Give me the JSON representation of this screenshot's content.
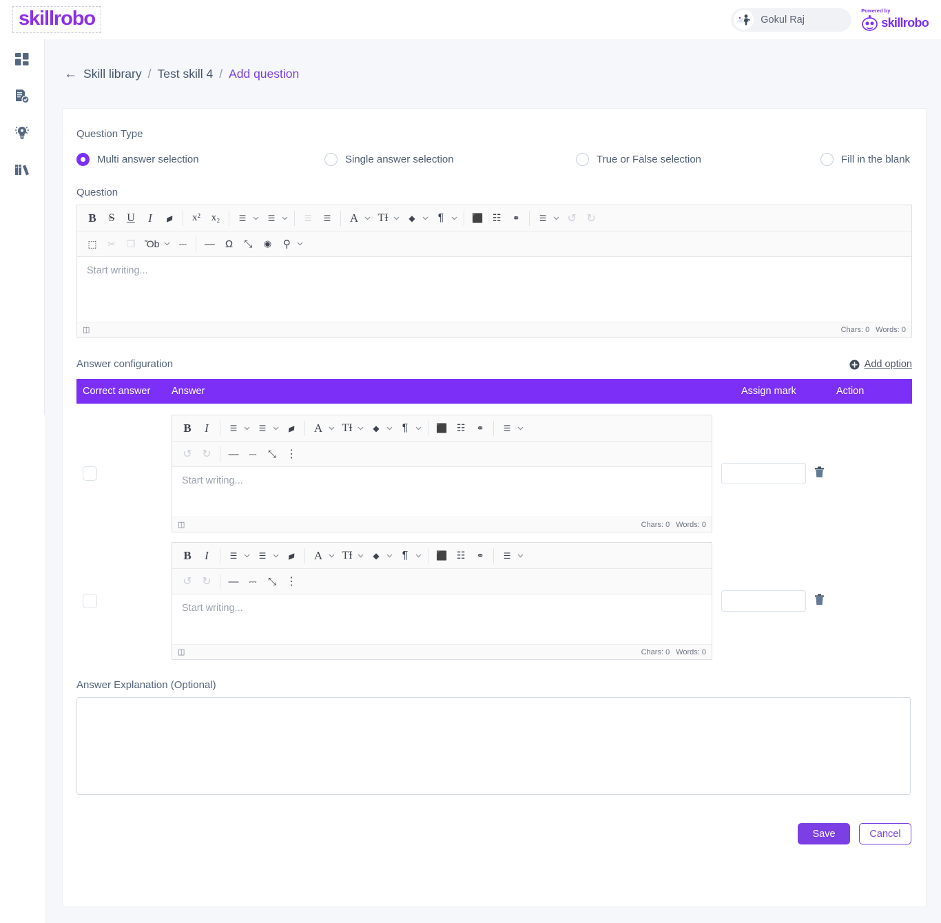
{
  "brand": {
    "logo_text": "skillrobo",
    "accent": "#7b2ff7",
    "purple_header": "#7b2ff7"
  },
  "header": {
    "user_name": "Gokul Raj",
    "powered_label": "Powered by",
    "powered_name": "skillrobo"
  },
  "sidebar": {
    "items": [
      {
        "icon": "dashboard-grid-icon",
        "name": "dashboard"
      },
      {
        "icon": "document-check-icon",
        "name": "assessments"
      },
      {
        "icon": "lightbulb-icon",
        "name": "skills"
      },
      {
        "icon": "books-icon",
        "name": "library"
      }
    ]
  },
  "breadcrumb": {
    "back": "←",
    "item1": "Skill library",
    "sep1": "/",
    "item2": "Test skill 4",
    "sep2": "/",
    "active": "Add question"
  },
  "question_type": {
    "label": "Question Type",
    "options": [
      {
        "label": "Multi answer selection",
        "selected": true
      },
      {
        "label": "Single answer selection",
        "selected": false
      },
      {
        "label": "True or False selection",
        "selected": false
      },
      {
        "label": "Fill in the blank",
        "selected": false
      }
    ]
  },
  "question": {
    "label": "Question",
    "placeholder": "Start writing...",
    "value": "",
    "chars": "Chars: 0",
    "words": "Words: 0"
  },
  "question_toolbar": {
    "row1": [
      {
        "n": "bold-icon",
        "g": "B",
        "style": "font-weight:700;font-family:'Liberation Serif',serif;font-size:17px"
      },
      {
        "n": "strikethrough-icon",
        "g": "S",
        "style": "font-family:'Liberation Serif',serif;font-size:16px;text-decoration:line-through"
      },
      {
        "n": "underline-icon",
        "g": "U",
        "style": "font-family:'Liberation Serif',serif;font-size:16px;text-decoration:underline"
      },
      {
        "n": "italic-icon",
        "g": "I",
        "style": "font-style:italic;font-family:'Liberation Serif',serif;font-size:17px"
      },
      {
        "n": "remove-format-eraser-icon",
        "g": "▰",
        "style": "font-size:15px;transform:rotate(-22deg)"
      },
      {
        "sep": true
      },
      {
        "n": "superscript-icon",
        "g": "x²",
        "style": "font-family:'Liberation Serif',serif;font-size:15px"
      },
      {
        "n": "subscript-icon",
        "g": "x₂",
        "style": "font-family:'Liberation Serif',serif;font-size:15px"
      },
      {
        "sep": true
      },
      {
        "n": "bulleted-list-icon",
        "g": "☰",
        "style": "font-size:12px"
      },
      {
        "caret": true,
        "n": "bulleted-list-dropdown-icon"
      },
      {
        "n": "numbered-list-icon",
        "g": "☰",
        "style": "font-size:12px"
      },
      {
        "caret": true,
        "n": "numbered-list-dropdown-icon"
      },
      {
        "sep": true
      },
      {
        "n": "outdent-icon",
        "g": "☰",
        "style": "font-size:12px",
        "dis": true
      },
      {
        "n": "indent-icon",
        "g": "☰",
        "style": "font-size:12px"
      },
      {
        "sep": true
      },
      {
        "n": "font-family-icon",
        "g": "A",
        "style": "font-family:'Liberation Serif',serif;font-size:17px"
      },
      {
        "caret": true,
        "n": "font-family-dropdown-icon"
      },
      {
        "n": "font-size-icon",
        "g": "TƗ",
        "style": "font-family:'Liberation Serif',serif;font-size:16px"
      },
      {
        "caret": true,
        "n": "font-size-dropdown-icon"
      },
      {
        "n": "text-color-droplet-icon",
        "g": "◆",
        "style": "font-size:12px"
      },
      {
        "caret": true,
        "n": "text-color-dropdown-icon"
      },
      {
        "n": "paragraph-format-icon",
        "g": "¶",
        "style": "font-size:16px"
      },
      {
        "caret": true,
        "n": "paragraph-format-dropdown-icon"
      },
      {
        "sep": true
      },
      {
        "n": "insert-image-icon",
        "g": "⬛",
        "style": "font-size:13px"
      },
      {
        "n": "insert-table-icon",
        "g": "☷",
        "style": "font-size:14px"
      },
      {
        "n": "insert-link-icon",
        "g": "⚭",
        "style": "font-size:13px"
      },
      {
        "sep": true
      },
      {
        "n": "align-icon",
        "g": "☰",
        "style": "font-size:12px"
      },
      {
        "caret": true,
        "n": "align-dropdown-icon"
      },
      {
        "n": "undo-icon",
        "g": "↺",
        "style": "font-size:16px",
        "dis": true
      },
      {
        "n": "redo-icon",
        "g": "↻",
        "style": "font-size:16px",
        "dis": true
      }
    ],
    "row2": [
      {
        "n": "select-all-icon",
        "g": "⬚",
        "style": "font-size:14px"
      },
      {
        "n": "cut-icon",
        "g": "✂",
        "style": "font-size:14px",
        "dis": true
      },
      {
        "n": "copy-icon",
        "g": "❐",
        "style": "font-size:14px",
        "dis": true
      },
      {
        "n": "paste-icon",
        "g": "Ὄb",
        "style": "font-size:14px"
      },
      {
        "caret": true,
        "n": "paste-dropdown-icon"
      },
      {
        "n": "format-painter-icon",
        "g": "⎓",
        "style": "font-size:14px"
      },
      {
        "sep": true
      },
      {
        "n": "horizontal-rule-icon",
        "g": "—",
        "style": "font-size:15px"
      },
      {
        "n": "special-character-icon",
        "g": "Ω",
        "style": "font-size:15px"
      },
      {
        "n": "fullscreen-icon",
        "g": "⤡",
        "style": "font-size:15px"
      },
      {
        "n": "preview-eye-icon",
        "g": "◉",
        "style": "font-size:13px"
      },
      {
        "n": "search-icon",
        "g": "⚲",
        "style": "font-size:15px"
      },
      {
        "caret": true,
        "n": "search-dropdown-icon"
      }
    ]
  },
  "answer_config": {
    "label": "Answer configuration",
    "add_option": "Add option",
    "columns": {
      "correct": "Correct answer",
      "answer": "Answer",
      "mark": "Assign mark",
      "action": "Action"
    },
    "rows": [
      {
        "checked": false,
        "placeholder": "Start writing...",
        "value": "",
        "mark": "",
        "chars": "Chars: 0",
        "words": "Words: 0"
      },
      {
        "checked": false,
        "placeholder": "Start writing...",
        "value": "",
        "mark": "",
        "chars": "Chars: 0",
        "words": "Words: 0"
      }
    ]
  },
  "answer_toolbar": {
    "row1": [
      {
        "n": "bold-icon",
        "g": "B",
        "style": "font-weight:700;font-family:'Liberation Serif',serif;font-size:17px"
      },
      {
        "n": "italic-icon",
        "g": "I",
        "style": "font-style:italic;font-family:'Liberation Serif',serif;font-size:17px"
      },
      {
        "sep": true
      },
      {
        "n": "bulleted-list-icon",
        "g": "☰",
        "style": "font-size:12px"
      },
      {
        "caret": true,
        "n": "bulleted-list-dropdown-icon"
      },
      {
        "n": "numbered-list-icon",
        "g": "☰",
        "style": "font-size:12px"
      },
      {
        "caret": true,
        "n": "numbered-list-dropdown-icon"
      },
      {
        "n": "remove-format-eraser-icon",
        "g": "▰",
        "style": "font-size:15px;transform:rotate(-22deg)"
      },
      {
        "sep": true
      },
      {
        "n": "font-family-icon",
        "g": "A",
        "style": "font-family:'Liberation Serif',serif;font-size:17px"
      },
      {
        "caret": true,
        "n": "font-family-dropdown-icon"
      },
      {
        "n": "font-size-icon",
        "g": "TƗ",
        "style": "font-family:'Liberation Serif',serif;font-size:16px"
      },
      {
        "caret": true,
        "n": "font-size-dropdown-icon"
      },
      {
        "n": "text-color-droplet-icon",
        "g": "◆",
        "style": "font-size:12px"
      },
      {
        "caret": true,
        "n": "text-color-dropdown-icon"
      },
      {
        "n": "paragraph-format-icon",
        "g": "¶",
        "style": "font-size:16px"
      },
      {
        "caret": true,
        "n": "paragraph-format-dropdown-icon"
      },
      {
        "sep": true
      },
      {
        "n": "insert-image-icon",
        "g": "⬛",
        "style": "font-size:13px"
      },
      {
        "n": "insert-table-icon",
        "g": "☷",
        "style": "font-size:14px"
      },
      {
        "n": "insert-link-icon",
        "g": "⚭",
        "style": "font-size:13px"
      },
      {
        "sep": true
      },
      {
        "n": "align-icon",
        "g": "☰",
        "style": "font-size:12px"
      },
      {
        "caret": true,
        "n": "align-dropdown-icon"
      }
    ],
    "row2": [
      {
        "n": "undo-icon",
        "g": "↺",
        "style": "font-size:16px",
        "dis": true
      },
      {
        "n": "redo-icon",
        "g": "↻",
        "style": "font-size:16px",
        "dis": true
      },
      {
        "sep": true
      },
      {
        "n": "horizontal-rule-icon",
        "g": "—",
        "style": "font-size:15px"
      },
      {
        "n": "format-painter-icon",
        "g": "⎓",
        "style": "font-size:14px"
      },
      {
        "n": "fullscreen-icon",
        "g": "⤡",
        "style": "font-size:15px"
      },
      {
        "n": "more-options-icon",
        "g": "⋮",
        "style": "font-size:16px"
      }
    ]
  },
  "explanation": {
    "label": "Answer Explanation (Optional)",
    "placeholder": "",
    "value": ""
  },
  "footer": {
    "save": "Save",
    "cancel": "Cancel"
  }
}
